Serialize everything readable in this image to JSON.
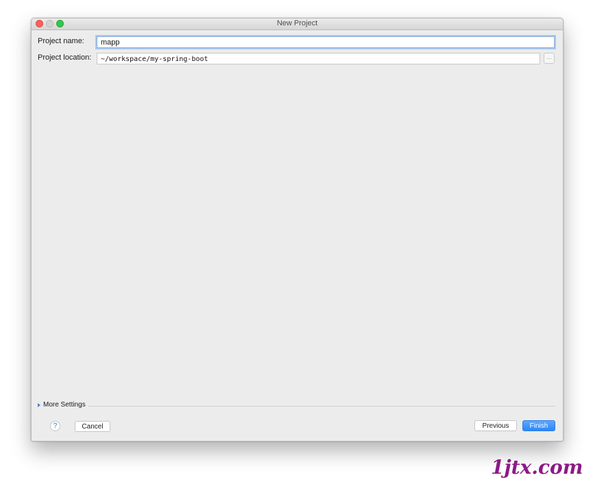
{
  "window": {
    "title": "New Project"
  },
  "form": {
    "project_name_label": "Project name:",
    "project_name_value": "mapp",
    "project_location_label": "Project location:",
    "project_location_value": "~/workspace/my-spring-boot",
    "browse_label": "..."
  },
  "more_settings": {
    "label": "More Settings"
  },
  "footer": {
    "help_label": "?",
    "cancel_label": "Cancel",
    "previous_label": "Previous",
    "finish_label": "Finish"
  },
  "watermark": {
    "text": "1jtx.com"
  },
  "colors": {
    "close": "#fc605b",
    "minimize": "#d3d3d3",
    "zoom": "#34c84a",
    "primary_button": "#2b86f6",
    "watermark": "#8c1a85"
  }
}
